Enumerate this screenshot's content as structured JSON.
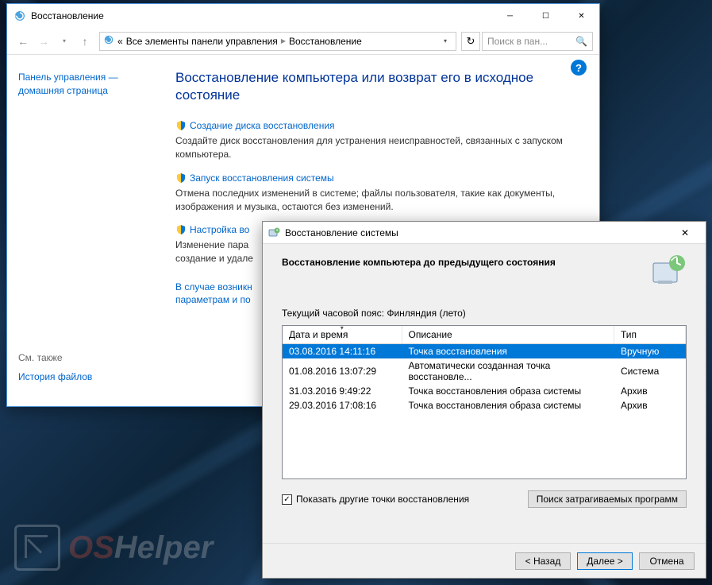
{
  "cp": {
    "title": "Восстановление",
    "breadcrumb": {
      "prefix": "«",
      "b1": "Все элементы панели управления",
      "b2": "Восстановление"
    },
    "search_placeholder": "Поиск в пан...",
    "sidebar": {
      "home1": "Панель управления —",
      "home2": "домашняя страница",
      "see_also": "См. также",
      "file_history": "История файлов"
    },
    "main": {
      "heading": "Восстановление компьютера или возврат его в исходное состояние",
      "items": [
        {
          "link": "Создание диска восстановления",
          "desc": "Создайте диск восстановления для устранения неисправностей, связанных с запуском компьютера."
        },
        {
          "link": "Запуск восстановления системы",
          "desc": "Отмена последних изменений в системе; файлы пользователя, такие как документы, изображения и музыка, остаются без изменений."
        },
        {
          "link": "Настройка во",
          "desc": "Изменение пара\nсоздание и удале"
        },
        {
          "link": "В случае возникн",
          "desc": "параметрам и по"
        }
      ]
    }
  },
  "dlg": {
    "title": "Восстановление системы",
    "heading": "Восстановление компьютера до предыдущего состояния",
    "tz": "Текущий часовой пояс: Финляндия (лето)",
    "cols": {
      "c1": "Дата и время",
      "c2": "Описание",
      "c3": "Тип"
    },
    "rows": [
      {
        "dt": "03.08.2016 14:11:16",
        "desc": "Точка восстановления",
        "type": "Вручную"
      },
      {
        "dt": "01.08.2016 13:07:29",
        "desc": "Автоматически созданная точка восстановле...",
        "type": "Система"
      },
      {
        "dt": "31.03.2016 9:49:22",
        "desc": "Точка восстановления образа системы",
        "type": "Архив"
      },
      {
        "dt": "29.03.2016 17:08:16",
        "desc": "Точка восстановления образа системы",
        "type": "Архив"
      }
    ],
    "show_other": "Показать другие точки восстановления",
    "scan_btn": "Поиск затрагиваемых программ",
    "back": "< Назад",
    "next": "Далее >",
    "cancel": "Отмена"
  },
  "watermark": {
    "os": "OS",
    "helper": "Helper"
  }
}
